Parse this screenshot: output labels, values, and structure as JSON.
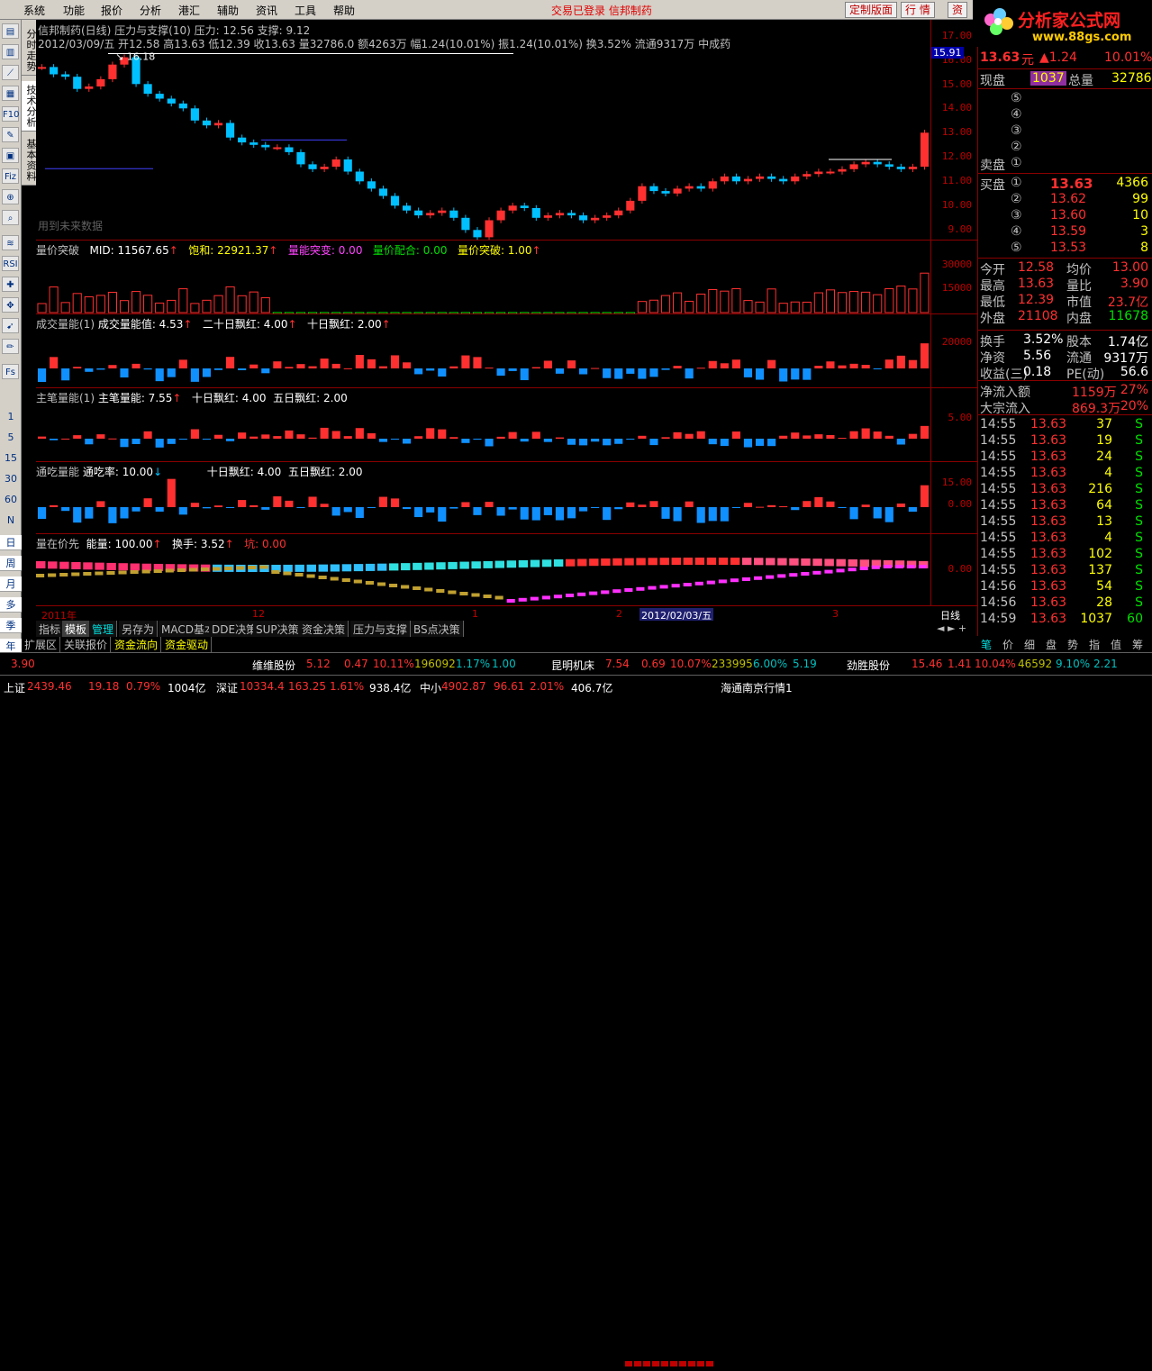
{
  "menu": {
    "items": [
      "系统",
      "功能",
      "报价",
      "分析",
      "港汇",
      "辅助",
      "资讯",
      "工具",
      "帮助"
    ],
    "status": "交易已登录  信邦制药",
    "buttons": [
      "定制版面",
      "行  情",
      "资"
    ]
  },
  "logo": {
    "title": "分析家公式网",
    "url": "www.88gs.com"
  },
  "lefttool": {
    "icons": [
      "quote-icon",
      "bar-icon",
      "line-icon",
      "grid-icon",
      "f10-icon",
      "notes-icon",
      "calc-icon",
      "fiz-icon",
      "compass-icon",
      "search-icon",
      "macd-icon",
      "rsi-icon",
      "alarm-icon",
      "move-icon",
      "draw-icon",
      "pen-icon",
      "fs-icon"
    ],
    "periods": [
      "1",
      "5",
      "15",
      "30",
      "60",
      "N",
      "日",
      "周",
      "月",
      "多",
      "季",
      "年"
    ]
  },
  "vtabs": [
    "分时走势",
    "技术分析",
    "基本资料"
  ],
  "main": {
    "title": "信邦制药(日线) 压力与支撑(10)  压力: 12.56       支撑: 9.12",
    "ohlc": "2012/03/09/五 开12.58 高13.63 低12.39 收13.63 量32786.0 额4263万 幅1.24(10.01%) 振1.24(10.01%) 换3.52% 流通9317万  中成药",
    "note": "用到未来数据",
    "high_label": "16.18",
    "low_label": "9.12",
    "cur_price": "15.91",
    "axis": [
      "17.00",
      "16.00",
      "15.00",
      "14.00",
      "13.00",
      "12.00",
      "11.00",
      "10.00",
      "9.00"
    ]
  },
  "panels": [
    {
      "title": "量价突破",
      "fields": [
        "MID: 11567.65",
        "饱和: 22921.37",
        "量能突变: 0.00",
        "量价配合: 0.00",
        "量价突破: 1.00"
      ],
      "axis": [
        "30000",
        "15000"
      ]
    },
    {
      "title": "成交量能(1)",
      "fields": [
        "成交量能值: 4.53",
        "二十日飘红: 4.00",
        "十日飘红: 2.00"
      ],
      "axis": [
        "20000"
      ]
    },
    {
      "title": "主笔量能(1)",
      "fields": [
        "主笔量能: 7.55",
        "十日飘红: 4.00",
        "五日飘红: 2.00"
      ],
      "axis": [
        "5.00"
      ]
    },
    {
      "title": "通吃量能",
      "fields": [
        "通吃率: 10.00",
        "十日飘红: 4.00",
        "五日飘红: 2.00"
      ],
      "axis": [
        "15.00",
        "0.00"
      ]
    },
    {
      "title": "量在价先",
      "fields": [
        "能量: 100.00",
        "换手: 3.52",
        "坑: 0.00"
      ],
      "axis": [
        "0.00"
      ]
    }
  ],
  "dates": [
    "2011年",
    "12",
    "1",
    "2",
    "2012/02/03/五",
    "3",
    "日线"
  ],
  "tabs1": [
    "指标",
    "模板",
    "管理",
    "另存为",
    "MACD基本",
    "DDE决策",
    "SUP决策",
    "资金决策",
    "压力与支撑",
    "BS点决策"
  ],
  "tabs2": [
    "扩展区",
    "关联报价",
    "资金流向",
    "资金驱动"
  ],
  "quote": {
    "price": "13.63",
    "unit": "元",
    "change": "▲1.24",
    "pct": "10.01%",
    "xianpan_label": "现盘",
    "xianpan": "1037",
    "zongpan_label": "总量",
    "zongpan": "32786",
    "sell": [
      "⑤",
      "④",
      "③",
      "②",
      "①"
    ],
    "sell_label": "卖盘",
    "buy_label": "买盘",
    "buy": [
      {
        "n": "①",
        "p": "13.63",
        "v": "4366"
      },
      {
        "n": "②",
        "p": "13.62",
        "v": "99"
      },
      {
        "n": "③",
        "p": "13.60",
        "v": "10"
      },
      {
        "n": "④",
        "p": "13.59",
        "v": "3"
      },
      {
        "n": "⑤",
        "p": "13.53",
        "v": "8"
      }
    ],
    "stats": [
      [
        "今开",
        "12.58",
        "均价",
        "13.00"
      ],
      [
        "最高",
        "13.63",
        "量比",
        "3.90"
      ],
      [
        "最低",
        "12.39",
        "市值",
        "23.7亿"
      ],
      [
        "外盘",
        "21108",
        "内盘",
        "11678"
      ]
    ],
    "stats2": [
      [
        "换手",
        "3.52%",
        "股本",
        "1.74亿"
      ],
      [
        "净资",
        "5.56",
        "流通",
        "9317万"
      ],
      [
        "收益(三)",
        "0.18",
        "PE(动)",
        "56.6"
      ]
    ],
    "flow": [
      [
        "净流入额",
        "1159万",
        "27%"
      ],
      [
        "大宗流入",
        "869.3万",
        "20%"
      ]
    ],
    "ticks": [
      [
        "14:55",
        "13.63",
        "37",
        "S"
      ],
      [
        "14:55",
        "13.63",
        "19",
        "S"
      ],
      [
        "14:55",
        "13.63",
        "24",
        "S"
      ],
      [
        "14:55",
        "13.63",
        "4",
        "S"
      ],
      [
        "14:55",
        "13.63",
        "216",
        "S"
      ],
      [
        "14:55",
        "13.63",
        "64",
        "S"
      ],
      [
        "14:55",
        "13.63",
        "13",
        "S"
      ],
      [
        "14:55",
        "13.63",
        "4",
        "S"
      ],
      [
        "14:55",
        "13.63",
        "102",
        "S"
      ],
      [
        "14:55",
        "13.63",
        "137",
        "S"
      ],
      [
        "14:56",
        "13.63",
        "54",
        "S"
      ],
      [
        "14:56",
        "13.63",
        "28",
        "S"
      ],
      [
        "14:59",
        "13.63",
        "1037",
        "60"
      ]
    ],
    "rtabs": [
      "笔",
      "价",
      "细",
      "盘",
      "势",
      "指",
      "值",
      "筹"
    ]
  },
  "ticker": [
    {
      "name": "",
      "vals": [
        "3.90"
      ]
    },
    {
      "name": "维维股份",
      "vals": [
        "5.12",
        "0.47",
        "10.11%",
        "196092",
        "1.17%",
        "1.00"
      ]
    },
    {
      "name": "昆明机床",
      "vals": [
        "7.54",
        "0.69",
        "10.07%",
        "233995",
        "6.00%",
        "5.19"
      ]
    },
    {
      "name": "劲胜股份",
      "vals": [
        "15.46",
        "1.41",
        "10.04%",
        "46592",
        "9.10%",
        "2.21"
      ]
    }
  ],
  "status": {
    "sh": [
      "上证",
      "2439.46",
      "19.18",
      "0.79%",
      "1004亿"
    ],
    "sz": [
      "深证",
      "10334.4",
      "163.25",
      "1.61%",
      "938.4亿"
    ],
    "zx": [
      "中小",
      "4902.87",
      "96.61",
      "2.01%",
      "406.7亿"
    ],
    "src": "海通南京行情1"
  },
  "colors": {
    "up": "#ff3030",
    "down": "#00c0ff",
    "border": "#8b0000",
    "yellow": "#ffff00",
    "green": "#00e000"
  }
}
